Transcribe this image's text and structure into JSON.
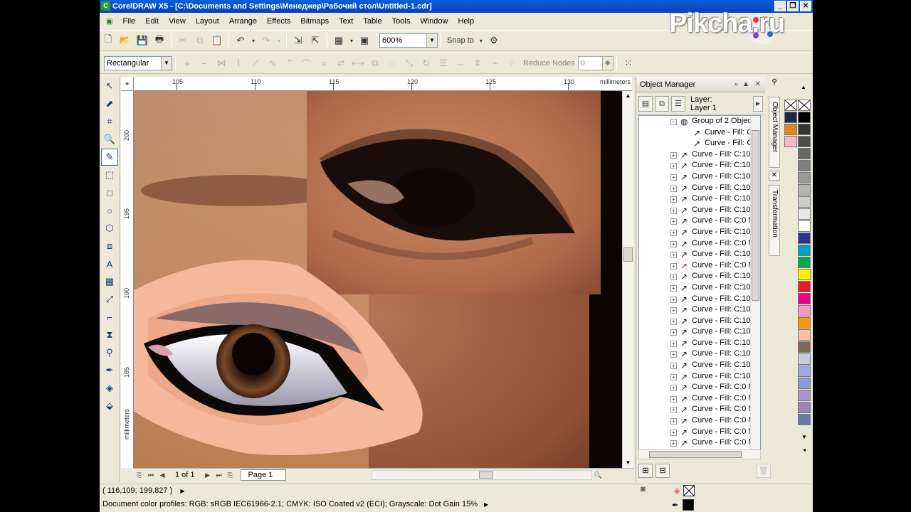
{
  "window": {
    "title": "CorelDRAW X5 - [C:\\Documents and Settings\\Менеджер\\Рабочий стол\\Untitled-1.cdr]",
    "app_icon": "coreldraw-icon"
  },
  "watermark": {
    "text": "Pikcha.ru"
  },
  "menu": [
    "File",
    "Edit",
    "View",
    "Layout",
    "Arrange",
    "Effects",
    "Bitmaps",
    "Text",
    "Table",
    "Tools",
    "Window",
    "Help"
  ],
  "toolbar": {
    "zoom_value": "600%",
    "snap_label": "Snap to"
  },
  "property_bar": {
    "mode_value": "Rectangular",
    "reduce_nodes_label": "Reduce Nodes",
    "reduce_nodes_value": "0"
  },
  "rulers": {
    "h_ticks": [
      "105",
      "110",
      "115",
      "120",
      "125",
      "130"
    ],
    "h_unit": "millimeters",
    "v_ticks": [
      "200",
      "195",
      "190",
      "185"
    ],
    "v_unit": "millimeters"
  },
  "page_nav": {
    "count": "1 of 1",
    "tab": "Page 1"
  },
  "status": {
    "coords": "( 116,109; 199,827 )",
    "profiles": "Document color profiles: RGB: sRGB IEC61966-2.1; CMYK: ISO Coated v2 (ECI); Grayscale: Dot Gain 15%"
  },
  "docker": {
    "title": "Object Manager",
    "layer_line1": "Layer:",
    "layer_line2": "Layer 1",
    "group_label": "Group of 2 Object",
    "child_items": [
      "Curve - Fill: C",
      "Curve - Fill: C"
    ],
    "items": [
      "Curve - Fill: C:100",
      "Curve - Fill: C:100",
      "Curve - Fill: C:100",
      "Curve - Fill: C:100",
      "Curve - Fill: C:100",
      "Curve - Fill: C:100",
      "Curve - Fill: C:0 M",
      "Curve - Fill: C:100",
      "Curve - Fill: C:0 M",
      "Curve - Fill: C:100",
      "Curve - Fill: C:0 M",
      "Curve - Fill: C:100",
      "Curve - Fill: C:100",
      "Curve - Fill: C:100",
      "Curve - Fill: C:100",
      "Curve - Fill: C:100",
      "Curve - Fill: C:100",
      "Curve - Fill: C:100",
      "Curve - Fill: C:100",
      "Curve - Fill: C:100",
      "Curve - Fill: C:100",
      "Curve - Fill: C:0 M",
      "Curve - Fill: C:0 M",
      "Curve - Fill: C:0 M",
      "Curve - Fill: C:0 M",
      "Curve - Fill: C:0 M",
      "Curve - Fill: C:0 M"
    ]
  },
  "vertical_tabs": [
    "Object Manager",
    "Transformation"
  ],
  "palette": {
    "col1": [
      "none",
      "#1a2a55",
      "#d98a1a",
      "#f4b8c8"
    ],
    "col2": [
      "none",
      "#000000",
      "#333333",
      "#4d4d4d",
      "#666666",
      "#808080",
      "#999999",
      "#b3b3b3",
      "#cccccc",
      "#e6e6e6",
      "#ffffff",
      "#2e3192",
      "#00a0c6",
      "#00a651",
      "#fff200",
      "#ed1c24",
      "#ec008c",
      "#f49ac1",
      "#f7941d",
      "#f9bda0",
      "#7f6a55",
      "#c7c7e8",
      "#a0a8e8",
      "#8a9ad8",
      "#a894c8",
      "#9a86b8",
      "#6a7aa8"
    ]
  },
  "colors": {
    "title_bar": "#0a5fd8",
    "chrome": "#ece9d8",
    "skin": "#d59f7c",
    "vector_skin": "#f5b89a"
  }
}
